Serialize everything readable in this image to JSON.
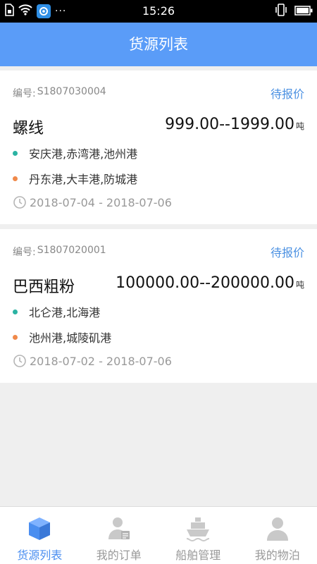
{
  "status_bar": {
    "time": "15:26",
    "left_icons": [
      "sim-icon",
      "wifi-icon",
      "app-notification-icon",
      "more-dots-icon"
    ],
    "right_icons": [
      "vibrate-icon",
      "battery-icon"
    ],
    "more_dots": "···"
  },
  "header": {
    "title": "货源列表"
  },
  "cargo_list": [
    {
      "code_label": "编号:",
      "code": "S1807030004",
      "status": "待报价",
      "name": "螺线",
      "price": "999.00--1999.00",
      "unit": "吨",
      "load_ports": "安庆港,赤湾港,池州港",
      "discharge_ports": "丹东港,大丰港,防城港",
      "date_range": "2018-07-04 - 2018-07-06"
    },
    {
      "code_label": "编号:",
      "code": "S1807020001",
      "status": "待报价",
      "name": "巴西粗粉",
      "price": "100000.00--200000.00",
      "unit": "吨",
      "load_ports": "北仑港,北海港",
      "discharge_ports": "池州港,城陵矶港",
      "date_range": "2018-07-02 - 2018-07-06"
    }
  ],
  "colors": {
    "header_bg": "#5a9cf8",
    "accent": "#4a8ef0",
    "load_dot": "#2bb3a3",
    "discharge_dot": "#f0894a"
  },
  "bottom_nav": [
    {
      "label": "货源列表",
      "icon": "box-icon",
      "active": true
    },
    {
      "label": "我的订单",
      "icon": "user-order-icon",
      "active": false
    },
    {
      "label": "船舶管理",
      "icon": "ship-icon",
      "active": false
    },
    {
      "label": "我的物泊",
      "icon": "person-icon",
      "active": false
    }
  ]
}
